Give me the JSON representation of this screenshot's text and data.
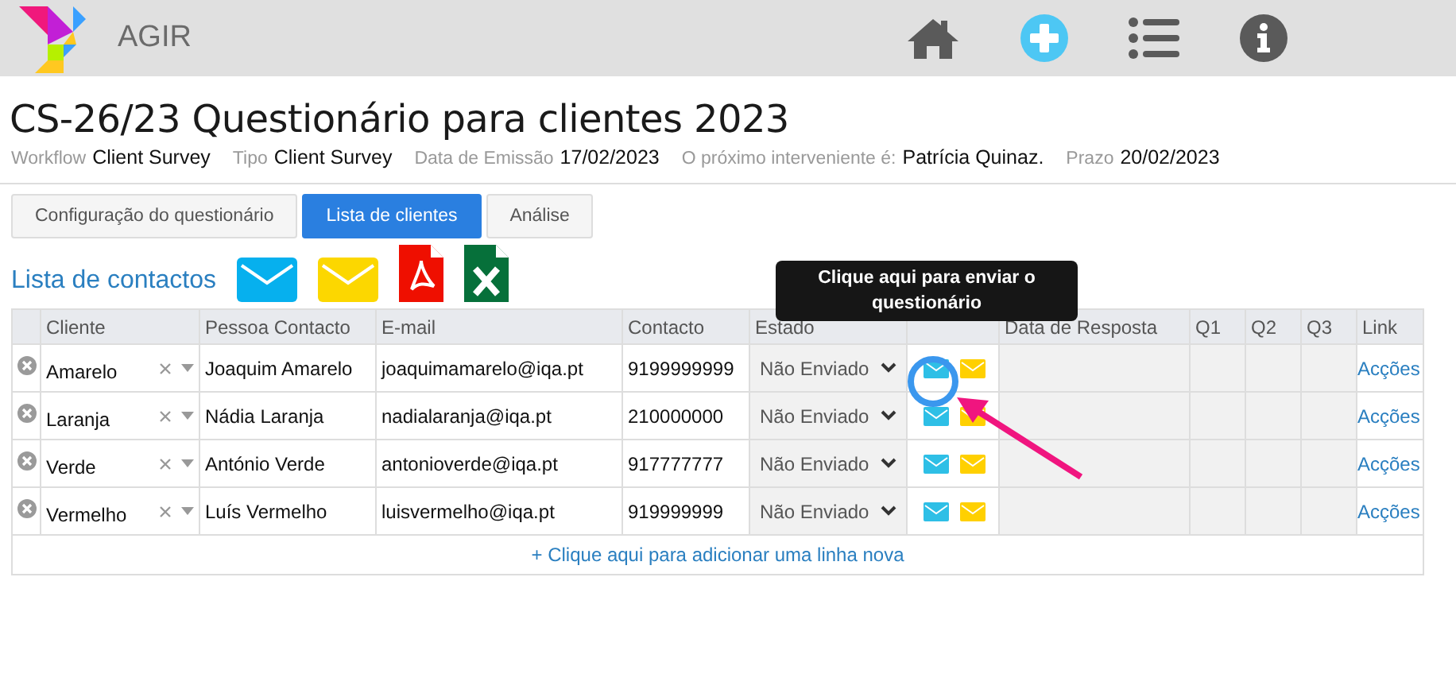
{
  "app": {
    "name": "AGIR"
  },
  "title": "CS-26/23 Questionário para clientes 2023",
  "meta": [
    {
      "label": "Workflow",
      "value": "Client Survey"
    },
    {
      "label": "Tipo",
      "value": "Client Survey"
    },
    {
      "label": "Data de Emissão",
      "value": "17/02/2023"
    },
    {
      "label": "O próximo interveniente é:",
      "value": "Patrícia Quinaz."
    },
    {
      "label": "Prazo",
      "value": "20/02/2023"
    }
  ],
  "tabs": [
    {
      "label": "Configuração do questionário",
      "selected": false
    },
    {
      "label": "Lista de clientes",
      "selected": true
    },
    {
      "label": "Análise",
      "selected": false
    }
  ],
  "section_title": "Lista de contactos",
  "table": {
    "columns": [
      "Cliente",
      "Pessoa Contacto",
      "E-mail",
      "Contacto",
      "Estado",
      "",
      "Data de Resposta",
      "Q1",
      "Q2",
      "Q3",
      "Link"
    ],
    "rows": [
      {
        "cliente": "Amarelo",
        "pessoa": "Joaquim Amarelo",
        "email": "joaquimamarelo@iqa.pt",
        "contacto": "9199999999",
        "estado": "Não Enviado",
        "link": "Acções"
      },
      {
        "cliente": "Laranja",
        "pessoa": "Nádia Laranja",
        "email": "nadialaranja@iqa.pt",
        "contacto": "210000000",
        "estado": "Não Enviado",
        "link": "Acções"
      },
      {
        "cliente": "Verde",
        "pessoa": "António Verde",
        "email": "antonioverde@iqa.pt",
        "contacto": "917777777",
        "estado": "Não Enviado",
        "link": "Acções"
      },
      {
        "cliente": "Vermelho",
        "pessoa": "Luís Vermelho",
        "email": "luisvermelho@iqa.pt",
        "contacto": "919999999",
        "estado": "Não Enviado",
        "link": "Acções"
      }
    ],
    "add_row": "+ Clique aqui para adicionar uma linha nova"
  },
  "tooltip": "Clique aqui para enviar o questionário"
}
